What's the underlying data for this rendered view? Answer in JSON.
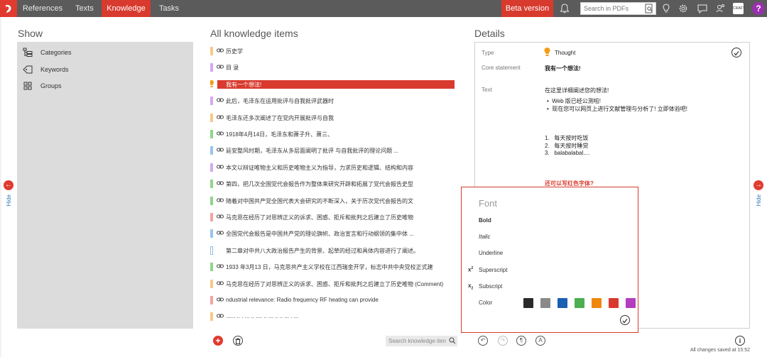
{
  "topbar": {
    "tabs": [
      {
        "label": "References"
      },
      {
        "label": "Texts"
      },
      {
        "label": "Knowledge"
      },
      {
        "label": "Tasks"
      }
    ],
    "beta_label": "Beta version",
    "search_placeholder": "Search in PDFs",
    "app_badge": "CRAFT",
    "help_label": "?"
  },
  "hide": {
    "left_label": "Hide",
    "right_label": "Hide"
  },
  "show": {
    "title": "Show",
    "items": [
      {
        "label": "Categories",
        "icon": "categories-icon"
      },
      {
        "label": "Keywords",
        "icon": "keywords-icon"
      },
      {
        "label": "Groups",
        "icon": "groups-icon"
      }
    ]
  },
  "knowledge": {
    "title": "All knowledge items",
    "search_placeholder": "Search knowledge iten",
    "items": [
      {
        "text": "历史学",
        "color": "#f7c98a"
      },
      {
        "text": "目 录",
        "color": "#d5a9f0"
      },
      {
        "text": "我有一个想法!",
        "color": "#d83a2e",
        "selected": true
      },
      {
        "text": "此后，毛泽东在运用批评与自我批评武器时",
        "color": "#d5a9f0"
      },
      {
        "text": "毛泽东还多次阐述了在党内开展批评与自我",
        "color": "#f7c98a"
      },
      {
        "text": "1918年4月14日，毛泽东和萧子升、萧三、",
        "color": "#8fd68a"
      },
      {
        "text": "延安整风时期，毛泽东从多层面阐明了批评 与自我批评的理论问题 ...",
        "color": "#9bc4ee"
      },
      {
        "text": "本文以辩证唯物主义和历史唯物主义为指导，力求历史和逻辑、结构和内容",
        "color": "#d5a9f0"
      },
      {
        "text": "第四，把几次全国党代会报告作为整体来研究开辟和拓展了党代会报告史型",
        "color": "#8fd68a"
      },
      {
        "text": "随着对中国共产党全国代表大会研究的不断深入，关于历次党代会报告的文",
        "color": "#8fd68a"
      },
      {
        "text": "马克思在经历了对思辨正义的诉求、困惑、拒斥和批判之后建立了历史唯物",
        "color": "#f4a3a0"
      },
      {
        "text": "全国党代会报告是中国共产党的理论旗帜、政治宣言和行动纲领的集中体 ...",
        "color": "#9bc4ee"
      },
      {
        "text": "第二章对中共八大政治报告产生的背景、起草的经过和具体内容进行了阐述。",
        "color": "outline"
      },
      {
        "text": "1933 年3月13 日，马克思共产主义学校在江西瑞金开学，标志中共中央党校正式建",
        "color": "#8fd68a"
      },
      {
        "text": "马克思在经历了对思辨正义的诉求、困惑、拒斥和批判之后建立了历史唯物 (Comment)",
        "color": "#f7c98a"
      },
      {
        "text": "ndustrial relevance: Radio frequency RF heating can provide",
        "color": "#f4a3a0"
      },
      {
        "text": "...... .. . ... .. .... .. ... .. .. ... . ...",
        "color": "#f7c98a"
      }
    ]
  },
  "details": {
    "title": "Details",
    "type_label": "Type",
    "type_value": "Thought",
    "core_label": "Core statement",
    "core_value": "我有一个想法!",
    "text_label": "Text",
    "text_intro": "在这里详细阐述您的想法!",
    "bullets": [
      "Web 版已经公测啦!",
      "现在您可以网页上进行文献管理与分析了! 立即体验吧!"
    ],
    "numbered": [
      "每天按时吃饭",
      "每天按时睡觉",
      "balabalabal...."
    ],
    "red_line": "还可以写红色字体?",
    "saved_text": "All changes saved at 15:52"
  },
  "font_popup": {
    "title": "Font",
    "bold": "Bold",
    "italic": "Italic",
    "underline": "Underline",
    "superscript": "Superscript",
    "subscript": "Subscript",
    "color_label": "Color",
    "colors": [
      "#2a2a2a",
      "#8a8a8a",
      "#1a5fb4",
      "#4caf50",
      "#f0870f",
      "#d83a2e",
      "#b43cbf"
    ]
  }
}
